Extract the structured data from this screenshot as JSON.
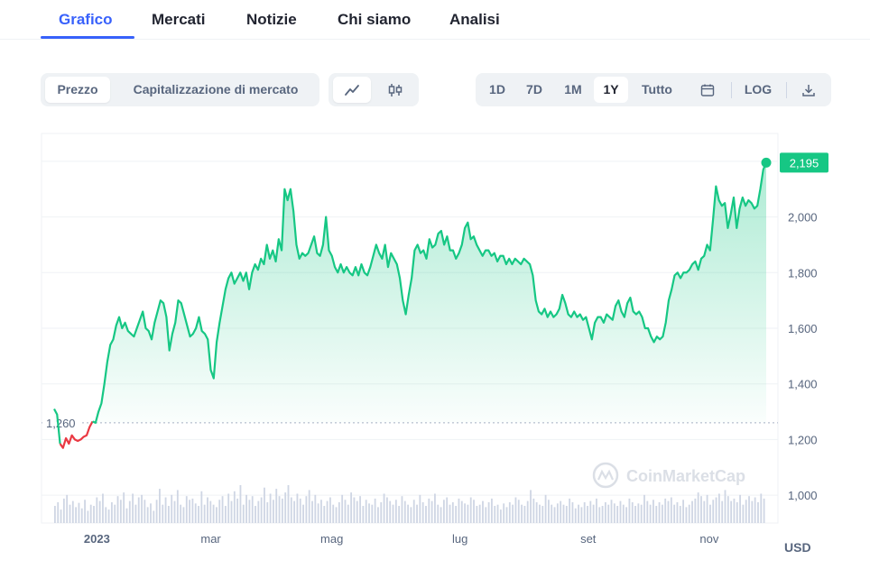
{
  "tabs": [
    "Grafico",
    "Mercati",
    "Notizie",
    "Chi siamo",
    "Analisi"
  ],
  "toolbar": {
    "metric_tabs": [
      "Prezzo",
      "Capitalizzazione di mercato"
    ],
    "chart_type_icons": [
      "line-chart-icon",
      "candlestick-icon"
    ],
    "ranges": [
      "1D",
      "7D",
      "1M",
      "1Y",
      "Tutto"
    ],
    "active_range": "1Y",
    "log_label": "LOG",
    "icons": [
      "calendar-icon",
      "download-icon"
    ]
  },
  "colors": {
    "accent": "#3861fb",
    "up": "#16c784",
    "down": "#ea3943"
  },
  "chart_data": {
    "type": "line",
    "x_tick_labels": [
      "2023",
      "mar",
      "mag",
      "lug",
      "set",
      "nov"
    ],
    "y_ticks": [
      1000,
      1200,
      1400,
      1600,
      1800,
      2000
    ],
    "ylim": [
      900,
      2300
    ],
    "y_unit": "USD",
    "reference_value": 1260,
    "reference_label": "1,260",
    "last_value": 2195,
    "last_label": "2,195",
    "watermark": "CoinMarketCap",
    "series": [
      {
        "values": [
          1310,
          1290,
          1185,
          1170,
          1205,
          1185,
          1215,
          1200,
          1195,
          1200,
          1210,
          1215,
          1245,
          1265,
          1260,
          1300,
          1330,
          1400,
          1480,
          1540,
          1560,
          1610,
          1640,
          1600,
          1620,
          1590,
          1580,
          1570,
          1600,
          1630,
          1660,
          1600,
          1590,
          1560,
          1620,
          1660,
          1700,
          1690,
          1640,
          1520,
          1580,
          1620,
          1700,
          1690,
          1650,
          1610,
          1570,
          1580,
          1600,
          1640,
          1590,
          1580,
          1560,
          1450,
          1420,
          1550,
          1620,
          1680,
          1740,
          1780,
          1800,
          1760,
          1780,
          1800,
          1770,
          1800,
          1740,
          1800,
          1830,
          1810,
          1850,
          1830,
          1900,
          1850,
          1880,
          1840,
          1920,
          1880,
          2100,
          2060,
          2100,
          2020,
          1900,
          1850,
          1870,
          1860,
          1870,
          1900,
          1930,
          1870,
          1860,
          1900,
          2000,
          1880,
          1860,
          1820,
          1800,
          1830,
          1800,
          1820,
          1800,
          1790,
          1820,
          1790,
          1830,
          1800,
          1790,
          1820,
          1860,
          1900,
          1870,
          1850,
          1900,
          1820,
          1870,
          1850,
          1830,
          1780,
          1700,
          1650,
          1720,
          1780,
          1880,
          1900,
          1870,
          1880,
          1850,
          1920,
          1890,
          1900,
          1940,
          1950,
          1900,
          1930,
          1880,
          1880,
          1850,
          1870,
          1900,
          1960,
          1980,
          1920,
          1930,
          1900,
          1880,
          1860,
          1880,
          1880,
          1860,
          1870,
          1840,
          1860,
          1860,
          1830,
          1850,
          1830,
          1850,
          1840,
          1830,
          1850,
          1840,
          1830,
          1790,
          1700,
          1660,
          1650,
          1670,
          1640,
          1660,
          1640,
          1650,
          1670,
          1720,
          1690,
          1650,
          1640,
          1660,
          1640,
          1650,
          1630,
          1640,
          1600,
          1560,
          1620,
          1640,
          1640,
          1620,
          1650,
          1640,
          1630,
          1680,
          1700,
          1660,
          1640,
          1690,
          1710,
          1660,
          1650,
          1660,
          1640,
          1600,
          1600,
          1570,
          1550,
          1570,
          1560,
          1570,
          1620,
          1700,
          1740,
          1790,
          1800,
          1780,
          1800,
          1800,
          1810,
          1830,
          1840,
          1810,
          1850,
          1860,
          1900,
          1880,
          1990,
          2110,
          2060,
          2040,
          2050,
          1960,
          2010,
          2070,
          1960,
          2030,
          2070,
          2040,
          2060,
          2050,
          2030,
          2040,
          2100,
          2170,
          2195
        ]
      }
    ],
    "volume_values": [
      28,
      34,
      22,
      40,
      46,
      30,
      36,
      26,
      33,
      24,
      38,
      20,
      30,
      28,
      42,
      36,
      48,
      26,
      22,
      34,
      30,
      44,
      38,
      50,
      24,
      36,
      48,
      30,
      42,
      46,
      38,
      26,
      32,
      20,
      38,
      56,
      30,
      42,
      28,
      46,
      36,
      54,
      30,
      26,
      44,
      38,
      40,
      32,
      28,
      52,
      30,
      42,
      36,
      30,
      26,
      38,
      44,
      28,
      48,
      36,
      52,
      40,
      62,
      30,
      46,
      38,
      44,
      28,
      36,
      42,
      58,
      34,
      48,
      38,
      56,
      44,
      40,
      50,
      62,
      42,
      36,
      48,
      40,
      30,
      44,
      54,
      36,
      46,
      32,
      38,
      28,
      36,
      42,
      30,
      26,
      34,
      46,
      38,
      30,
      50,
      42,
      36,
      44,
      28,
      38,
      32,
      30,
      40,
      26,
      34,
      48,
      42,
      36,
      30,
      38,
      28,
      44,
      36,
      30,
      26,
      38,
      30,
      46,
      34,
      28,
      40,
      36,
      48,
      30,
      26,
      38,
      42,
      30,
      34,
      28,
      40,
      36,
      32,
      30,
      42,
      38,
      28,
      30,
      36,
      26,
      34,
      40,
      28,
      30,
      22,
      32,
      26,
      34,
      30,
      42,
      38,
      30,
      28,
      36,
      54,
      40,
      34,
      30,
      28,
      46,
      38,
      30,
      26,
      32,
      36,
      30,
      28,
      40,
      34,
      24,
      30,
      26,
      34,
      28,
      36,
      30,
      40,
      26,
      28,
      34,
      30,
      38,
      32,
      28,
      36,
      30,
      26,
      40,
      34,
      28,
      32,
      30,
      46,
      36,
      30,
      38,
      28,
      34,
      30,
      40,
      36,
      42,
      30,
      34,
      28,
      38,
      26,
      30,
      36,
      40,
      50,
      44,
      36,
      46,
      30,
      38,
      42,
      48,
      36,
      54,
      44,
      36,
      40,
      34,
      46,
      30,
      38,
      44,
      36,
      42,
      34,
      48,
      40
    ]
  }
}
